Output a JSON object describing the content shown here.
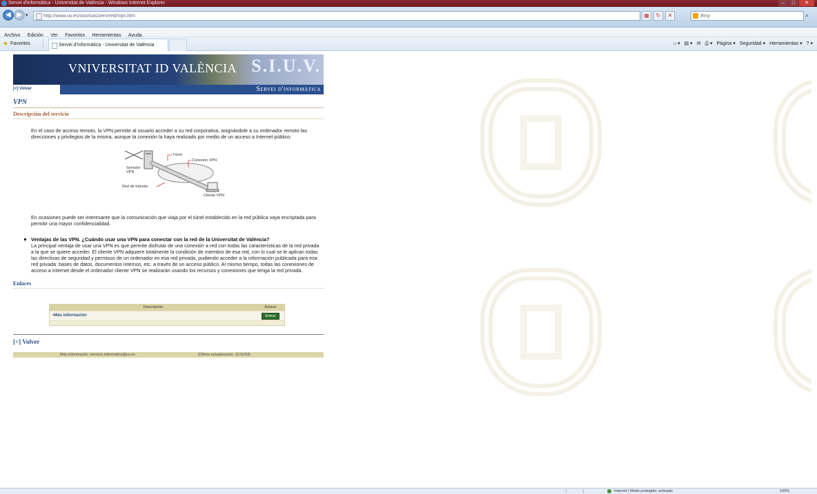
{
  "browser": {
    "window_title": "Servei d'informàtica - Universitat de València - Windows Internet Explorer",
    "address": "http://www.uv.es/siuv/cas/zerv/red/Vpn.htm",
    "search_placeholder": "Bing",
    "menu": [
      "Archivo",
      "Edición",
      "Ver",
      "Favoritos",
      "Herramientas",
      "Ayuda"
    ],
    "favorites_label": "Favoritos",
    "tab_title": "Servei d'informàtica - Universitat de València",
    "command_bar": [
      "Página ▾",
      "Seguridad ▾",
      "Herramientas ▾"
    ],
    "status_zone": "Internet | Modo protegido: activado",
    "zoom": "100%"
  },
  "page": {
    "logo_text": "VNIVERSITAT ID VALÈNCIA",
    "banner_text": "S.I.U.V.",
    "back_small": "[<] Volver",
    "section_banner": "Servei d'informàtica",
    "title": "VPN",
    "description_heading": "Descripción del servicio",
    "intro_paragraph": "En el caso de acceso remoto, la VPN permite al usuario acceder a su red corporativa, asignándole a su ordenador remoto las direcciones y privilegios de la misma, aunque la conexión la haya realizado por medio de un acceso a Internet público:",
    "diagram_labels": {
      "tunnel": "Túnel",
      "vpn_connection": "Conexión VPN",
      "vpn_server": "Servidor VPN",
      "transit_network": "Red de tránsito",
      "vpn_client": "Cliente VPN"
    },
    "encryption_paragraph": "En ocasiones puede ser interesante que la comunicación que viaja por el túnel establecido en la red pública vaya encriptada para permitir una mayor confidencialidad.",
    "advantages_title": "Ventajas de las VPN. ¿Cuándo usar una VPN para conectar con la red de la Universitat de València?",
    "advantages_text": "La principal ventaja de usar una VPN es que permite disfrutar de una conexión a red con todas las características de la red privada a la que se quiere acceder. El cliente VPN adquiere totalmente la condición de miembro de esa red, con lo cual se le aplican todas las directivas de seguridad y permisos de un ordenador en esa red privada, pudiendo acceder a la información publicada para esa red privada: bases de datos, documentos internos, etc. a través de un acceso público. Al mismo tiempo, todas las conexiones de acceso a Internet desde el ordenador cliente VPN se realizarán usando los recursos y conexiones que tenga la red privada.",
    "links_heading": "Enlaces",
    "links_table": {
      "headers": [
        "Descripción",
        "Enlace"
      ],
      "rows": [
        {
          "description": "Más información",
          "button": "Entrar"
        }
      ]
    },
    "back_link": "[<] Volver",
    "footer_info": "Más información: servicio.informatica@uv.es",
    "footer_updated": "[Última actualización: 11/11/03]"
  },
  "colors": {
    "title_bar": "#7a1f28",
    "uv_blue": "#294f8e",
    "heading_brown": "#a7603b",
    "footer_olive": "#dcd6a8",
    "enter_green": "#2e6e2a"
  }
}
